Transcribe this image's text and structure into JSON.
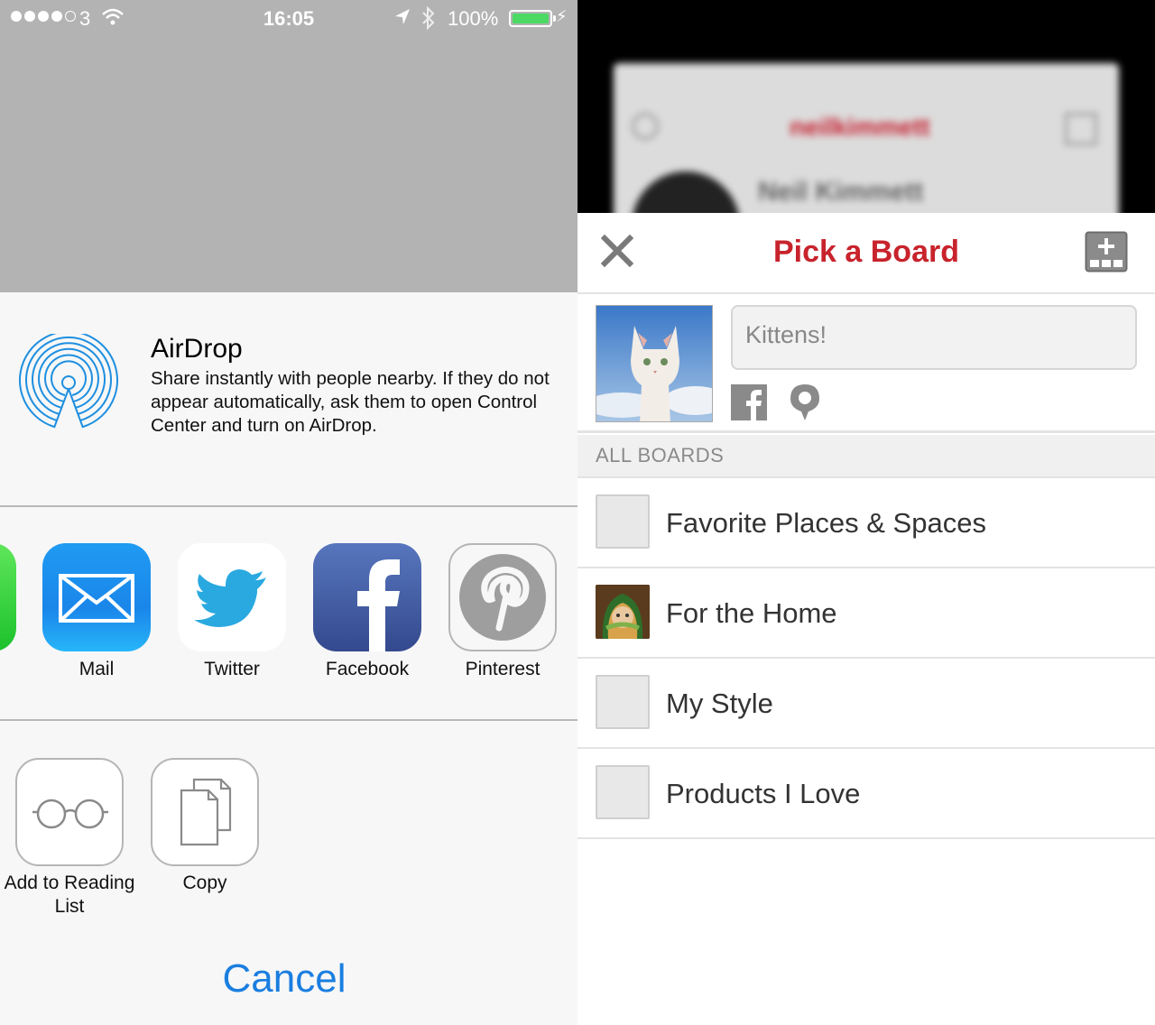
{
  "status_bar": {
    "carrier": "3",
    "time": "16:05",
    "battery_percent": "100%",
    "signal_dots_filled": 4,
    "signal_dots_total": 5
  },
  "share_sheet": {
    "airdrop": {
      "title": "AirDrop",
      "description": "Share instantly with people nearby. If they do not appear automatically, ask them to open Control Center and turn on AirDrop."
    },
    "apps": [
      {
        "label": "Mail",
        "icon": "mail-icon"
      },
      {
        "label": "Twitter",
        "icon": "twitter-icon"
      },
      {
        "label": "Facebook",
        "icon": "facebook-icon"
      },
      {
        "label": "Pinterest",
        "icon": "pinterest-icon"
      }
    ],
    "actions": [
      {
        "label": "Add to Reading List",
        "icon": "glasses-icon"
      },
      {
        "label": "Copy",
        "icon": "copy-icon"
      }
    ],
    "cancel_label": "Cancel"
  },
  "background_profile": {
    "username": "neilkimmett",
    "display_name": "Neil Kimmett"
  },
  "pin_sheet": {
    "title": "Pick a Board",
    "description_value": "Kittens!",
    "section_header": "ALL BOARDS",
    "boards": [
      {
        "name": "Favorite Places & Spaces",
        "has_image": false
      },
      {
        "name": "For the Home",
        "has_image": true
      },
      {
        "name": "My Style",
        "has_image": false
      },
      {
        "name": "Products I Love",
        "has_image": false
      }
    ]
  },
  "colors": {
    "pinterest_red": "#c8232c",
    "ios_blue": "#1a7ee0",
    "battery_green": "#4cd964",
    "airdrop_blue": "#1e8fe0"
  }
}
